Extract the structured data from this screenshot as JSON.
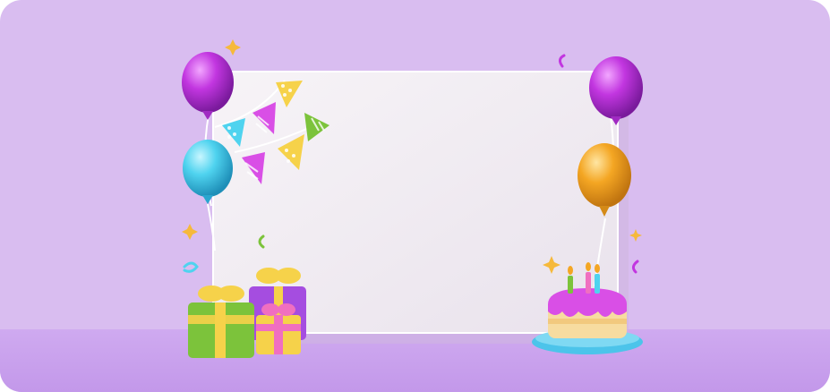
{
  "scene": {
    "description_id": "birthday-party-scene",
    "colors": {
      "background": "#d9bdf0",
      "floor": "#caa6ec",
      "board": "#f2eef3",
      "balloon_purple": "#c236e0",
      "balloon_blue": "#4fd3ef",
      "balloon_orange": "#f4a623",
      "gift_green": "#7cc33b",
      "gift_purple": "#a54de0",
      "gift_pink": "#f06fc0",
      "ribbon_yellow": "#f6d24a",
      "cake_icing": "#d94fe6",
      "cake_sponge": "#f7dca0",
      "cake_plate": "#4cc4ea"
    },
    "icons": [
      "balloon-icon",
      "bunting-flag-icon",
      "gift-box-icon",
      "birthday-cake-icon",
      "candle-icon",
      "sparkle-icon",
      "confetti-icon"
    ]
  }
}
